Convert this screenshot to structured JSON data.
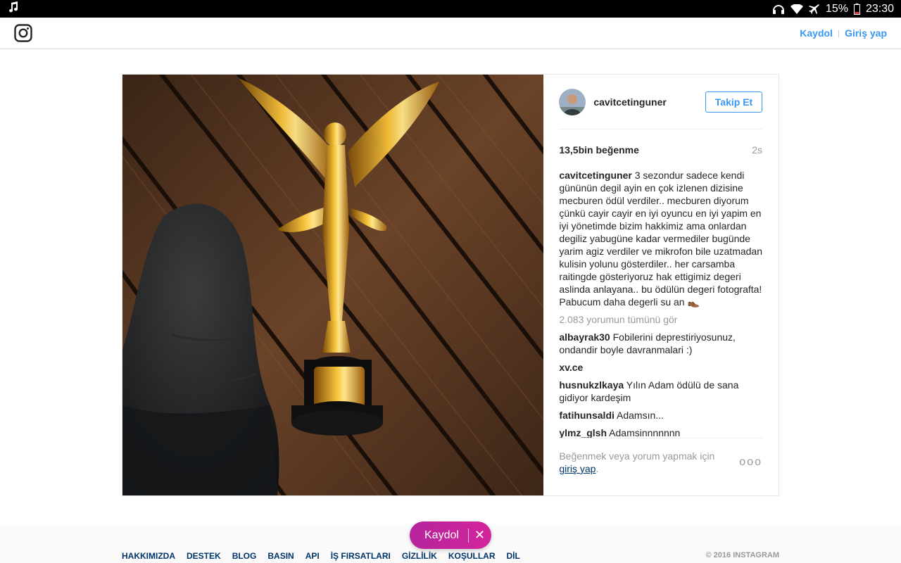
{
  "status_bar": {
    "battery": "15%",
    "time": "23:30"
  },
  "nav": {
    "signup_label": "Kaydol",
    "separator": "|",
    "login_label": "Giriş yap"
  },
  "post": {
    "username": "cavitcetinguner",
    "follow_label": "Takip Et",
    "likes": "13,5bin beğenme",
    "age": "2s",
    "caption": {
      "user": "cavitcetinguner",
      "text": "3 sezondur sadece kendi gününün degil ayin en çok izlenen dizisine mecburen ödül verdiler.. mecburen diyorum çünkü cayir cayir en iyi oyuncu en iyi yapim en iyi yönetimde bizim hakkimiz ama onlardan degiliz yabugüne kadar vermediler bugünde yarim agiz verdiler ve mikrofon bile uzatmadan kulisin yolunu gösterdiler.. her carsamba raitingde gösteriyoruz hak ettigimiz degeri aslinda anlayana.. bu ödülün degeri fotografta! Pabucum daha degerli su an 👞"
    },
    "view_all": "2.083 yorumun tümünü gör",
    "comments": [
      {
        "user": "albayrak30",
        "text": "Fobilerini deprestiriyosunuz, ondandir boyle davranmalari :)"
      },
      {
        "user": "xv.ce",
        "text": ""
      },
      {
        "user": "husnukzlkaya",
        "text": "Yılın Adam ödülü de sana gidiyor kardeşim"
      },
      {
        "user": "fatihunsaldi",
        "text": "Adamsın..."
      },
      {
        "user": "ylmz_glsh",
        "text": "Adamsinnnnnnn"
      }
    ],
    "prompt_text": "Beğenmek veya yorum yapmak için",
    "prompt_link": "giriş yap",
    "prompt_end": ".",
    "more_label": "ooo"
  },
  "footer": {
    "links": [
      "HAKKIMIZDA",
      "DESTEK",
      "BLOG",
      "BASIN",
      "API",
      "İŞ FIRSATLARI",
      "GİZLİLİK",
      "KOŞULLAR",
      "DİL"
    ],
    "copyright": "© 2016 INSTAGRAM"
  },
  "signup_pill": {
    "label": "Kaydol",
    "close": "✕"
  },
  "icons": {
    "status_left": "music-note-icon",
    "status_right": [
      "headset-icon",
      "wifi-icon",
      "airplane-icon",
      "battery-icon"
    ],
    "logo": "instagram-logo-icon"
  },
  "colors": {
    "link_blue": "#3897f0",
    "dark_link": "#003569",
    "pill_magenta": "#c1249c"
  }
}
